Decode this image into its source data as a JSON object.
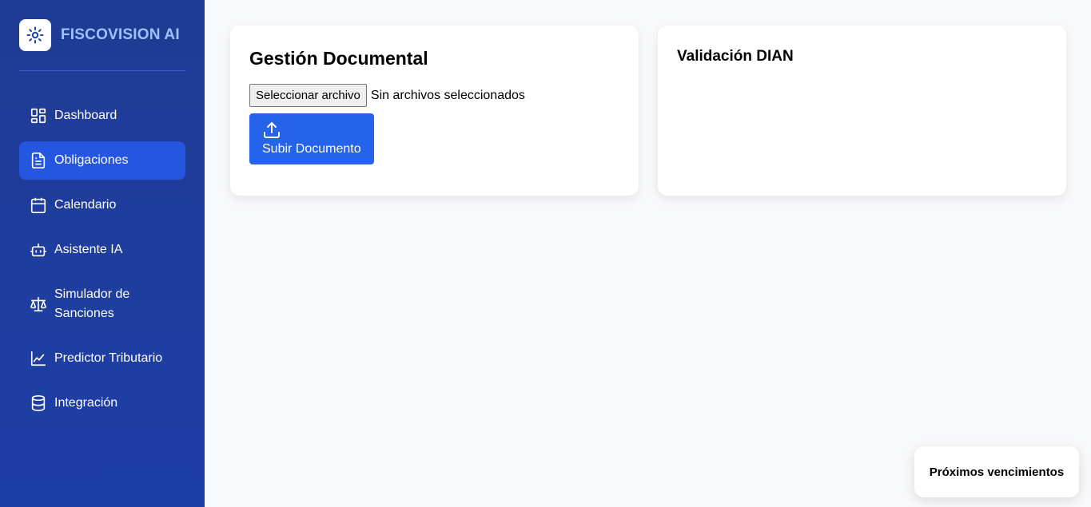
{
  "brand": {
    "title": "FISCOVISION AI",
    "logo_icon": "sun-icon"
  },
  "sidebar": {
    "items": [
      {
        "label": "Dashboard",
        "icon": "dashboard-icon",
        "active": false
      },
      {
        "label": "Obligaciones",
        "icon": "document-icon",
        "active": true
      },
      {
        "label": "Calendario",
        "icon": "calendar-icon",
        "active": false
      },
      {
        "label": "Asistente IA",
        "icon": "robot-icon",
        "active": false
      },
      {
        "label": "Simulador de Sanciones",
        "icon": "scale-icon",
        "active": false
      },
      {
        "label": "Predictor Tributario",
        "icon": "line-chart-icon",
        "active": false
      },
      {
        "label": "Integración",
        "icon": "database-icon",
        "active": false
      }
    ]
  },
  "documents": {
    "title": "Gestión Documental",
    "file_button": "Seleccionar archivo",
    "file_status": "Sin archivos seleccionados",
    "upload_label": "Subir Documento"
  },
  "dian": {
    "title": "Validación DIAN"
  },
  "deadlines": {
    "title": "Próximos vencimientos"
  },
  "colors": {
    "sidebar_top": "#1f3b93",
    "sidebar_bottom": "#1e3fa8",
    "active_item": "#2456e0",
    "primary_button": "#2563eb",
    "brand_text": "#9fc1ff"
  }
}
